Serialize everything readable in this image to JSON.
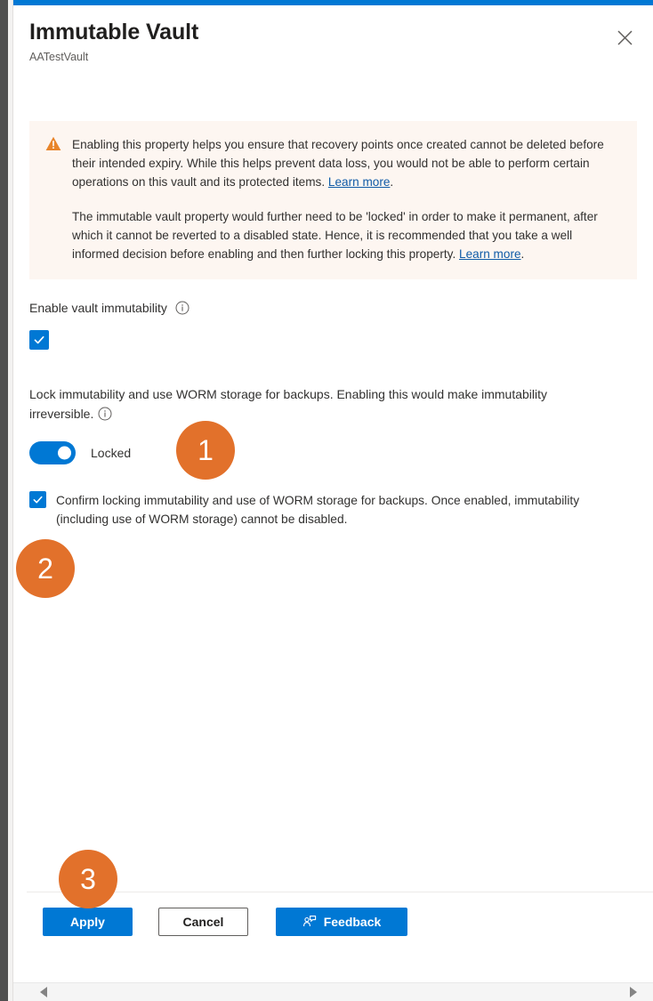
{
  "window": {
    "accent_color": "#0078d4",
    "badge_color": "#e2712b"
  },
  "header": {
    "title": "Immutable Vault",
    "subtitle": "AATestVault",
    "close_icon": "close-icon"
  },
  "warning": {
    "icon": "warning-triangle-icon",
    "paragraph_1_text": "Enabling this property helps you ensure that recovery points once created cannot be deleted before their intended expiry. While this helps prevent data loss, you would not be able to perform certain operations on this vault and its protected items. ",
    "paragraph_1_link": "Learn more",
    "paragraph_1_tail": ".",
    "paragraph_2_text": "The immutable vault property would further need to be 'locked' in order to make it permanent, after which it cannot be reverted to a disabled state. Hence, it is recommended that you take a well informed decision before enabling and then further locking this property. ",
    "paragraph_2_link": "Learn more",
    "paragraph_2_tail": "."
  },
  "enable_immutability": {
    "label": "Enable vault immutability",
    "info_icon": "info-circle-icon",
    "checkbox_checked": true,
    "check_icon": "checkmark-icon"
  },
  "lock_immutability": {
    "label": "Lock immutability and use WORM storage for backups. Enabling this would make immutability irreversible.",
    "info_icon": "info-circle-icon",
    "toggle_on": true,
    "toggle_label": "Locked"
  },
  "confirm": {
    "checkbox_checked": true,
    "check_icon": "checkmark-icon",
    "text": "Confirm locking immutability and use of WORM storage for backups. Once enabled, immutability (including use of WORM storage) cannot be disabled."
  },
  "footer": {
    "apply_label": "Apply",
    "cancel_label": "Cancel",
    "feedback_label": "Feedback",
    "feedback_icon": "feedback-person-icon"
  },
  "scrollbar": {
    "left_arrow_icon": "triangle-left-icon",
    "right_arrow_icon": "triangle-right-icon"
  },
  "annotations": [
    {
      "id": "1",
      "label": "1"
    },
    {
      "id": "2",
      "label": "2"
    },
    {
      "id": "3",
      "label": "3"
    }
  ]
}
